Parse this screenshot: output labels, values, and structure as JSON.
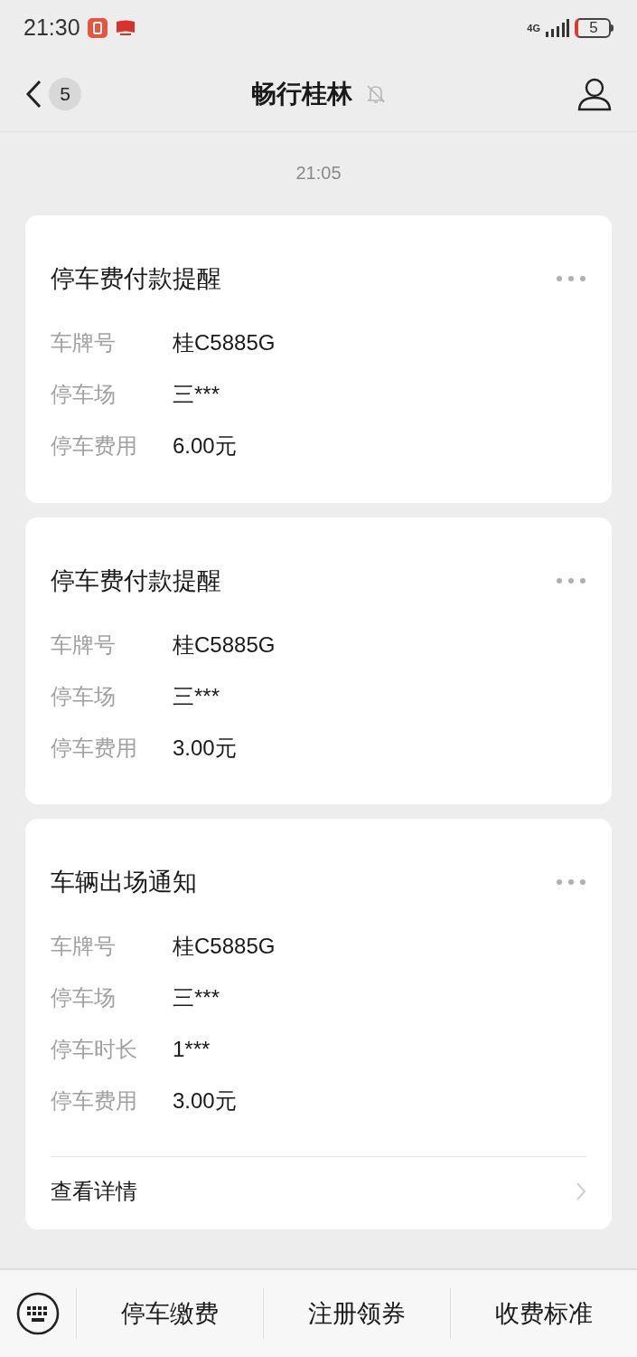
{
  "status_bar": {
    "time": "21:30",
    "network": "4G",
    "battery": "5"
  },
  "header": {
    "unread": "5",
    "title": "畅行桂林",
    "muted": true
  },
  "timestamp": "21:05",
  "cards": [
    {
      "title": "停车费付款提醒",
      "rows": [
        {
          "label": "车牌号",
          "value": "桂C5885G"
        },
        {
          "label": "停车场",
          "value": "三***"
        },
        {
          "label": "停车费用",
          "value": "6.00元"
        }
      ]
    },
    {
      "title": "停车费付款提醒",
      "rows": [
        {
          "label": "车牌号",
          "value": "桂C5885G"
        },
        {
          "label": "停车场",
          "value": "三***"
        },
        {
          "label": "停车费用",
          "value": "3.00元"
        }
      ]
    },
    {
      "title": "车辆出场通知",
      "rows": [
        {
          "label": "车牌号",
          "value": "桂C5885G"
        },
        {
          "label": "停车场",
          "value": "三***"
        },
        {
          "label": "停车时长",
          "value": "1***"
        },
        {
          "label": "停车费用",
          "value": "3.00元"
        }
      ],
      "link": "查看详情"
    }
  ],
  "menu": [
    "停车缴费",
    "注册领券",
    "收费标准"
  ]
}
